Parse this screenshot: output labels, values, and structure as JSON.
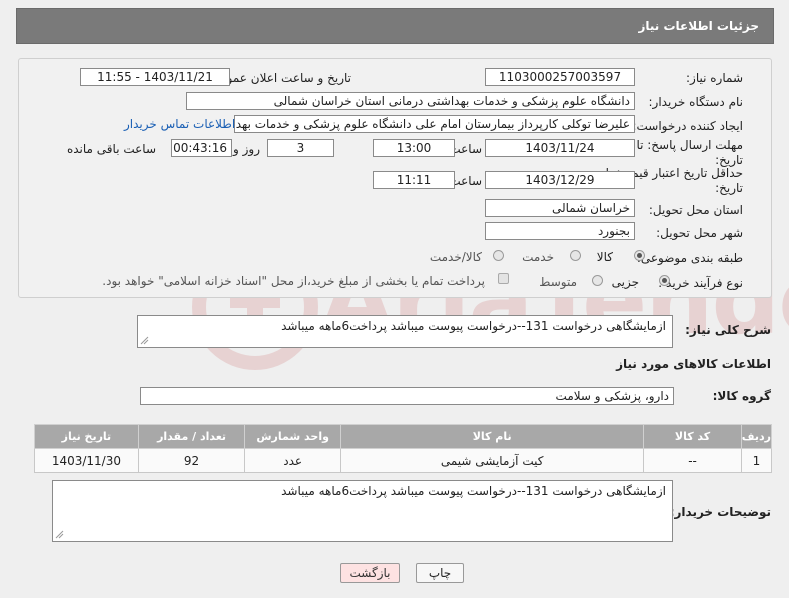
{
  "header": {
    "title": "جزئیات اطلاعات نیاز"
  },
  "fields": {
    "need_number_label": "شماره نیاز:",
    "need_number": "1103000257003597",
    "announce_label": "تاریخ و ساعت اعلان عمومی:",
    "announce_value": "1403/11/21 - 11:55",
    "buyer_org_label": "نام دستگاه خریدار:",
    "buyer_org": "دانشگاه علوم پزشکی و خدمات بهداشتی درمانی استان خراسان شمالی",
    "creator_label": "ایجاد کننده درخواست:",
    "creator": "علیرضا توکلی کارپرداز بیمارستان امام علی دانشگاه علوم پزشکی و خدمات بهدا",
    "contact_link": "اطلاعات تماس خریدار",
    "deadline_label_1": "مهلت ارسال پاسخ: تا",
    "deadline_label_2": "تاریخ:",
    "deadline_date": "1403/11/24",
    "time_label": "ساعت",
    "deadline_time": "13:00",
    "days_value": "3",
    "days_label": "روز و",
    "remaining_value": "00:43:16",
    "remaining_label": "ساعت باقی مانده",
    "validity_label_1": "حداقل تاریخ اعتبار قیمت: تا",
    "validity_label_2": "تاریخ:",
    "validity_date": "1403/12/29",
    "validity_time": "11:11",
    "province_label": "استان محل تحویل:",
    "province": "خراسان شمالی",
    "city_label": "شهر محل تحویل:",
    "city": "بجنورد",
    "category_label": "طبقه بندی موضوعی:",
    "category_options": [
      "کالا",
      "خدمت",
      "کالا/خدمت"
    ],
    "process_label": "نوع فرآیند خرید :",
    "process_options": [
      "جزیی",
      "متوسط"
    ],
    "payment_note": "پرداخت تمام یا بخشی از مبلغ خرید،از محل \"اسناد خزانه اسلامی\" خواهد بود."
  },
  "summary": {
    "label": "شرح کلی نیاز:",
    "text": "ازمایشگاهی درخواست 131--درخواست پیوست میباشد پرداخت6ماهه میباشد"
  },
  "goods_section_title": "اطلاعات کالاهای مورد نیاز",
  "goods_group": {
    "label": "گروه کالا:",
    "value": "دارو، پزشکی و سلامت"
  },
  "table": {
    "headers": [
      "ردیف",
      "کد کالا",
      "نام کالا",
      "واحد شمارش",
      "تعداد / مقدار",
      "تاریخ نیاز"
    ],
    "rows": [
      [
        "1",
        "--",
        "کیت آزمایشی شیمی",
        "عدد",
        "92",
        "1403/11/30"
      ]
    ]
  },
  "buyer_notes": {
    "label": "توضیحات خریدار:",
    "text": "ازمایشگاهی درخواست 131--درخواست پیوست میباشد پرداخت6ماهه میباشد"
  },
  "buttons": {
    "print": "چاپ",
    "back": "بازگشت"
  },
  "watermark": "AriaTender.neT",
  "colors": {
    "header_bg": "#7a7a7a",
    "table_header_bg": "#a8a8a8",
    "link": "#1a5fb4",
    "back_button_bg": "#fde2e2"
  }
}
